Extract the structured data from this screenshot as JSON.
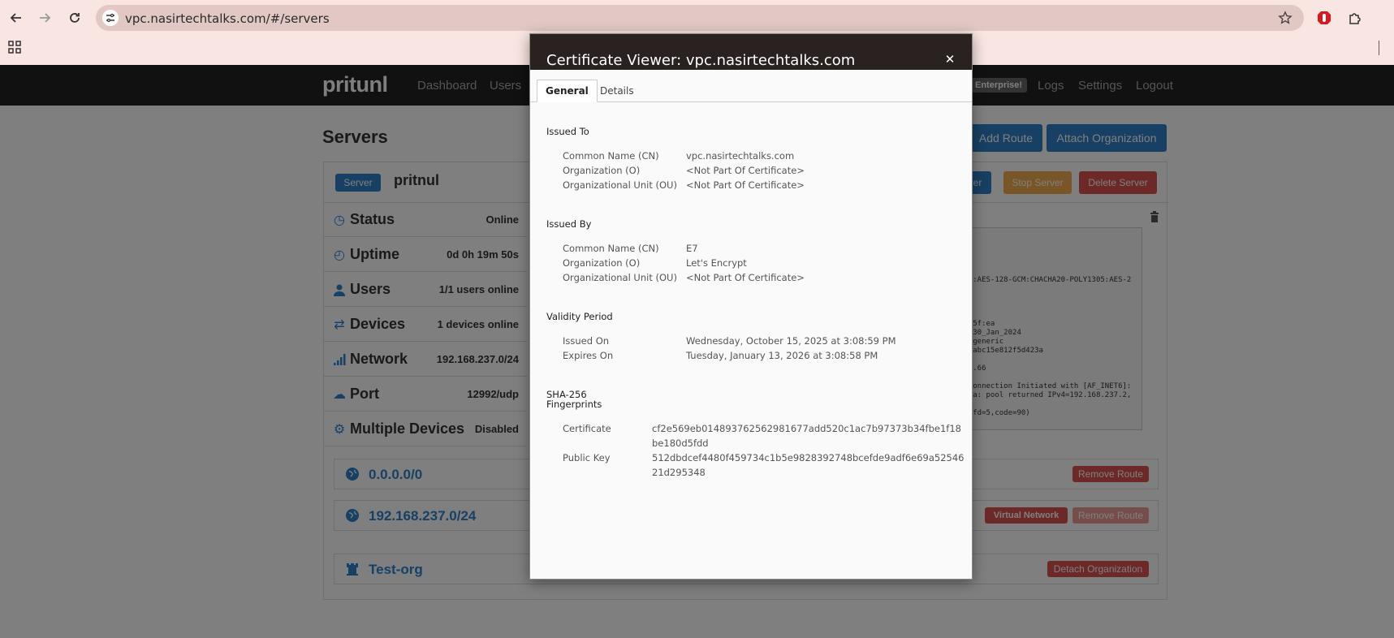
{
  "browser": {
    "url": "vpc.nasirtechtalks.com/#/servers"
  },
  "nav": {
    "brand": "pritunl",
    "links": [
      "Dashboard",
      "Users"
    ],
    "enterprise": "Enterprise!",
    "right_links": [
      "Logs",
      "Settings",
      "Logout"
    ]
  },
  "servers": {
    "title": "Servers",
    "add_route": "Add Route",
    "attach_org": "Attach Organization",
    "server_label": "Server",
    "server_name": "pritnul",
    "restart_partial": "ver",
    "stop_server": "Stop Server",
    "delete_server": "Delete Server",
    "stats": [
      {
        "key": "Status",
        "value": "Online",
        "icon": "clock-icon"
      },
      {
        "key": "Uptime",
        "value": "0d 0h 19m 50s",
        "icon": "history-icon"
      },
      {
        "key": "Users",
        "value": "1/1 users online",
        "icon": "user-icon"
      },
      {
        "key": "Devices",
        "value": "1 devices online",
        "icon": "transfer-icon"
      },
      {
        "key": "Network",
        "value": "192.168.237.0/24",
        "icon": "signal-icon"
      },
      {
        "key": "Port",
        "value": "12992/udp",
        "icon": "cloud-upload-icon"
      },
      {
        "key": "Multiple Devices",
        "value": "Disabled",
        "icon": "cog-icon"
      }
    ],
    "log_lines": [
      "GCM:AES-128-GCM:CHACHA20-POLY1305:AES-2",
      "a6:5f:ea",
      "13_30_Jan_2024",
      "43-generic",
      "707abc15e812f5d423a",
      "392.66",
      "r Connection Initiated with [AF_INET6]:",
      "_sva: pool returned IPv4=192.168.237.2,",
      "g (fd=5,code=90)"
    ],
    "routes": [
      {
        "name": "0.0.0.0/0",
        "remove": "Remove Route"
      },
      {
        "name": "192.168.237.0/24",
        "virtual": "Virtual Network",
        "remove": "Remove Route"
      }
    ],
    "org": {
      "name": "Test-org",
      "detach": "Detach Organization"
    }
  },
  "dialog": {
    "title": "Certificate Viewer: vpc.nasirtechtalks.com",
    "tabs": [
      "General",
      "Details"
    ],
    "issued_to": {
      "heading": "Issued To",
      "rows": [
        {
          "key": "Common Name (CN)",
          "value": "vpc.nasirtechtalks.com"
        },
        {
          "key": "Organization (O)",
          "value": "<Not Part Of Certificate>"
        },
        {
          "key": "Organizational Unit (OU)",
          "value": "<Not Part Of Certificate>"
        }
      ]
    },
    "issued_by": {
      "heading": "Issued By",
      "rows": [
        {
          "key": "Common Name (CN)",
          "value": "E7"
        },
        {
          "key": "Organization (O)",
          "value": "Let's Encrypt"
        },
        {
          "key": "Organizational Unit (OU)",
          "value": "<Not Part Of Certificate>"
        }
      ]
    },
    "validity": {
      "heading": "Validity Period",
      "rows": [
        {
          "key": "Issued On",
          "value": "Wednesday, October 15, 2025 at 3:08:59 PM"
        },
        {
          "key": "Expires On",
          "value": "Tuesday, January 13, 2026 at 3:08:58 PM"
        }
      ]
    },
    "fingerprints": {
      "heading_line1": "SHA-256",
      "heading_line2": "Fingerprints",
      "rows": [
        {
          "key": "Certificate",
          "value": "cf2e569eb014893762562981677add520c1ac7b97373b34fbe1f18be180d5fdd"
        },
        {
          "key": "Public Key",
          "value": "512dbdcef4480f459734c1b5e9828392748bcefde9adf6e69a5254621d295348"
        }
      ]
    }
  },
  "colors": {
    "chrome_bg": "#f9e5e1",
    "navbar": "#222222",
    "primary": "#2f80c8",
    "warning": "#f0ad4e",
    "danger": "#d9534f",
    "dialog_header": "#2a2121"
  }
}
